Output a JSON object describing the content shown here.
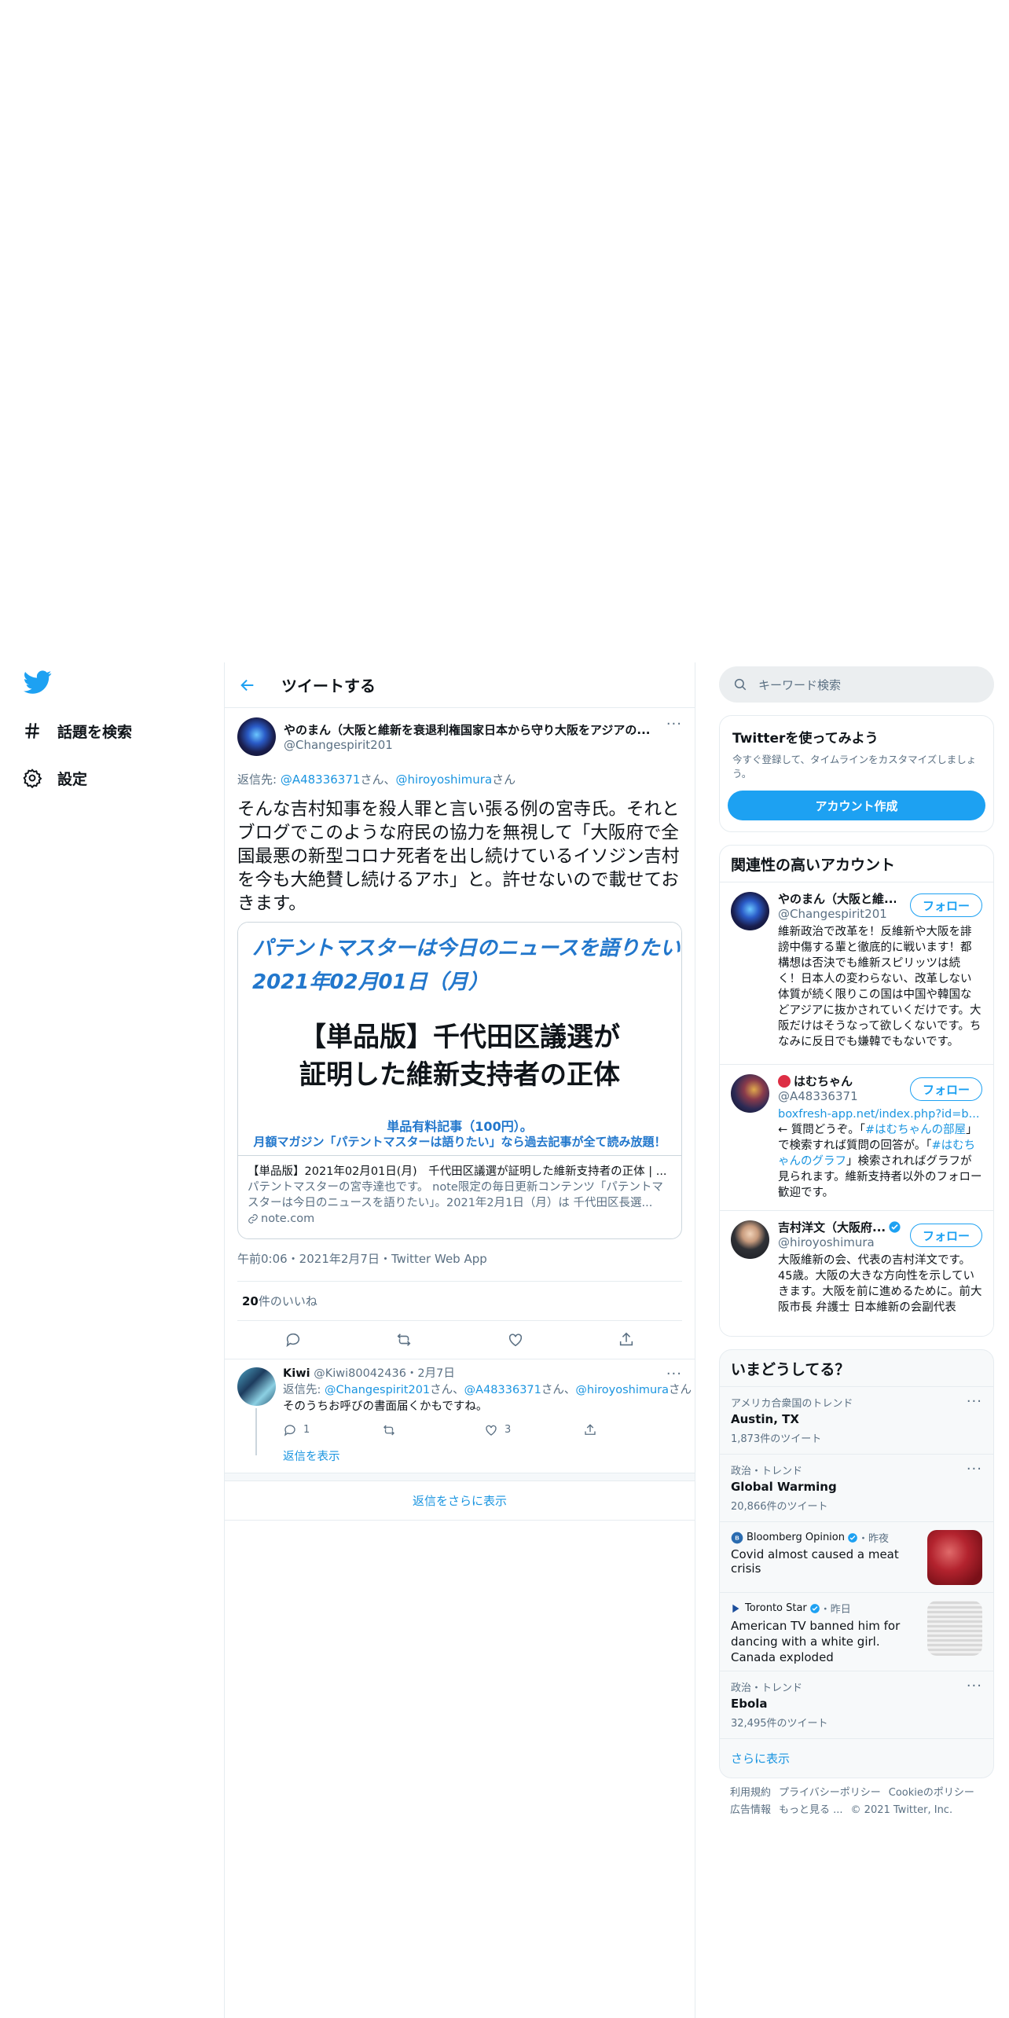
{
  "nav": {
    "logo": "twitter-bird-icon",
    "explore_label": "話題を検索",
    "settings_label": "設定"
  },
  "header": {
    "back_icon": "arrow-left-icon",
    "title": "ツイートする"
  },
  "tweet": {
    "author_name": "やのまん（大阪と維新を衰退利権国家日本から守り大阪をアジアの...",
    "author_handle": "@Changespirit201",
    "reply_to_prefix": "返信先: ",
    "reply_to_1": "@A48336371",
    "reply_to_sep": "さん、",
    "reply_to_2": "@hiroyoshimura",
    "reply_to_suffix": "さん",
    "text": "そんな吉村知事を殺人罪と言い張る例の宮寺氏。それとブログでこのような府民の協力を無視して「大阪府で全国最悪の新型コロナ死者を出し続けているイソジン吉村を今も大絶賛し続けるアホ」と。許せないので載せておきます。",
    "card": {
      "image_line1": "パテントマスターは今日のニュースを語りたい",
      "image_line2": "2021年02月01日（月）",
      "image_headline1": "【単品版】千代田区議選が",
      "image_headline2": "証明した維新支持者の正体",
      "image_footer1": "単品有料記事（100円）。",
      "image_footer2": "月額マガジン「パテントマスターは語りたい」なら過去記事が全て読み放題！",
      "title": "【単品版】2021年02月01日(月)　千代田区議選が証明した維新支持者の正体 | ...",
      "description": "パテントマスターの宮寺達也です。 note限定の毎日更新コンテンツ「パテントマスターは今日のニュースを語りたい」。2021年2月1日（月）は 千代田区長選...",
      "domain": "note.com"
    },
    "timestamp": "午前0:06・2021年2月7日・Twitter Web App",
    "likes_count": "20",
    "likes_label": " 件のいいね"
  },
  "reply": {
    "name": "Kiwi",
    "handle": "@Kiwi80042436",
    "date": "・2月7日",
    "reply_to_prefix": "返信先: ",
    "reply_to_1": "@Changespirit201",
    "reply_to_2": "@A48336371",
    "reply_to_3": "@hiroyoshimura",
    "san": "さん、",
    "san_end": "さん",
    "text": "そのうちお呼びの書面届くかもですね。",
    "reply_count": "1",
    "like_count": "3",
    "show_replies": "返信を表示"
  },
  "more_replies": "返信をさらに表示",
  "sidebar": {
    "search_placeholder": "キーワード検索",
    "signup": {
      "title": "Twitterを使ってみよう",
      "desc": "今すぐ登録して、タイムラインをカスタマイズしましょう。",
      "button": "アカウント作成"
    },
    "relevant": {
      "title": "関連性の高いアカウント",
      "follow": "フォロー",
      "accounts": [
        {
          "name": "やのまん（大阪と維...",
          "handle": "@Changespirit201",
          "bio": "維新政治で改革を！反維新や大阪を誹謗中傷する輩と徹底的に戦います！都構想は否決でも維新スピリッツは続く！日本人の変わらない、改革しない体質が続く限りこの国は中国や韓国などアジアに抜かされていくだけです。大阪だけはそうなって欲しくないです。ちなみに反日でも嫌韓でもないです。"
        },
        {
          "name": "はむちゃん",
          "handle": "@A48336371",
          "bio_link1": "boxfresh-app.net/index.php?id=b...",
          "bio_text1": " ← 質問どうぞ。「",
          "bio_link2": "#はむちゃんの部屋",
          "bio_text2": "」で検索すれば質問の回答が。「",
          "bio_link3": "#はむちゃんのグラフ",
          "bio_text3": "」検索されればグラフが見られます。維新支持者以外のフォロー歓迎です。"
        },
        {
          "name": "吉村洋文（大阪府...",
          "handle": "@hiroyoshimura",
          "bio": "大阪維新の会、代表の吉村洋文です。45歳。大阪の大きな方向性を示していきます。大阪を前に進めるために。前大阪市長 弁護士 日本維新の会副代表"
        }
      ]
    },
    "trends": {
      "title": "いまどうしてる？",
      "items": [
        {
          "meta": "アメリカ合衆国のトレンド",
          "name": "Austin, TX",
          "count": "1,873件のツイート"
        },
        {
          "meta": "政治・トレンド",
          "name": "Global Warming",
          "count": "20,866件のツイート"
        },
        {
          "source": "Bloomberg Opinion",
          "time": "・昨夜",
          "headline": "Covid almost caused a meat crisis"
        },
        {
          "source": "Toronto Star",
          "time": "・昨日",
          "headline": "American TV banned him for dancing with a white girl. Canada exploded"
        },
        {
          "meta": "政治・トレンド",
          "name": "Ebola",
          "count": "32,495件のツイート"
        }
      ],
      "show_more": "さらに表示"
    },
    "footer": {
      "terms": "利用規約",
      "privacy": "プライバシーポリシー",
      "cookie": "Cookieのポリシー",
      "ads": "広告情報",
      "more": "もっと見る ...",
      "copyright": "© 2021 Twitter, Inc."
    }
  },
  "colors": {
    "accent": "#1da1f2",
    "link": "#1b95e0",
    "secondary_text": "#5b7083",
    "border": "#e6ecf0"
  }
}
